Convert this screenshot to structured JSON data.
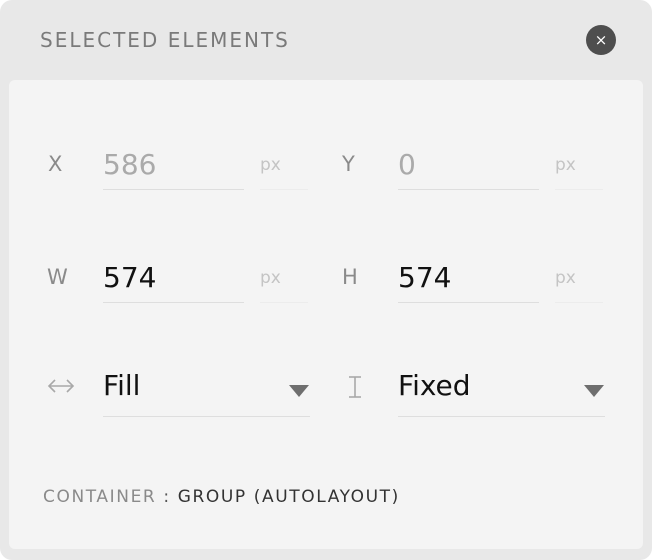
{
  "panel": {
    "title": "SELECTED ELEMENTS",
    "close_symbol": "×"
  },
  "fields": {
    "x": {
      "label": "X",
      "value": "586",
      "unit": "px"
    },
    "y": {
      "label": "Y",
      "value": "0",
      "unit": "px"
    },
    "w": {
      "label": "W",
      "value": "574",
      "unit": "px"
    },
    "h": {
      "label": "H",
      "value": "574",
      "unit": "px"
    }
  },
  "sizing": {
    "horizontal": {
      "icon": "horizontal-resize-icon",
      "value": "Fill"
    },
    "vertical": {
      "icon": "vertical-resize-icon",
      "value": "Fixed"
    }
  },
  "footer": {
    "label": "CONTAINER",
    "separator": " : ",
    "value": "GROUP (AUTOLAYOUT)"
  },
  "colors": {
    "panel_bg": "#e8e8e8",
    "content_bg": "#f4f4f4",
    "close_button_bg": "#4e4e4e",
    "muted_text": "#aaaaaa",
    "dark_text": "#111111"
  }
}
